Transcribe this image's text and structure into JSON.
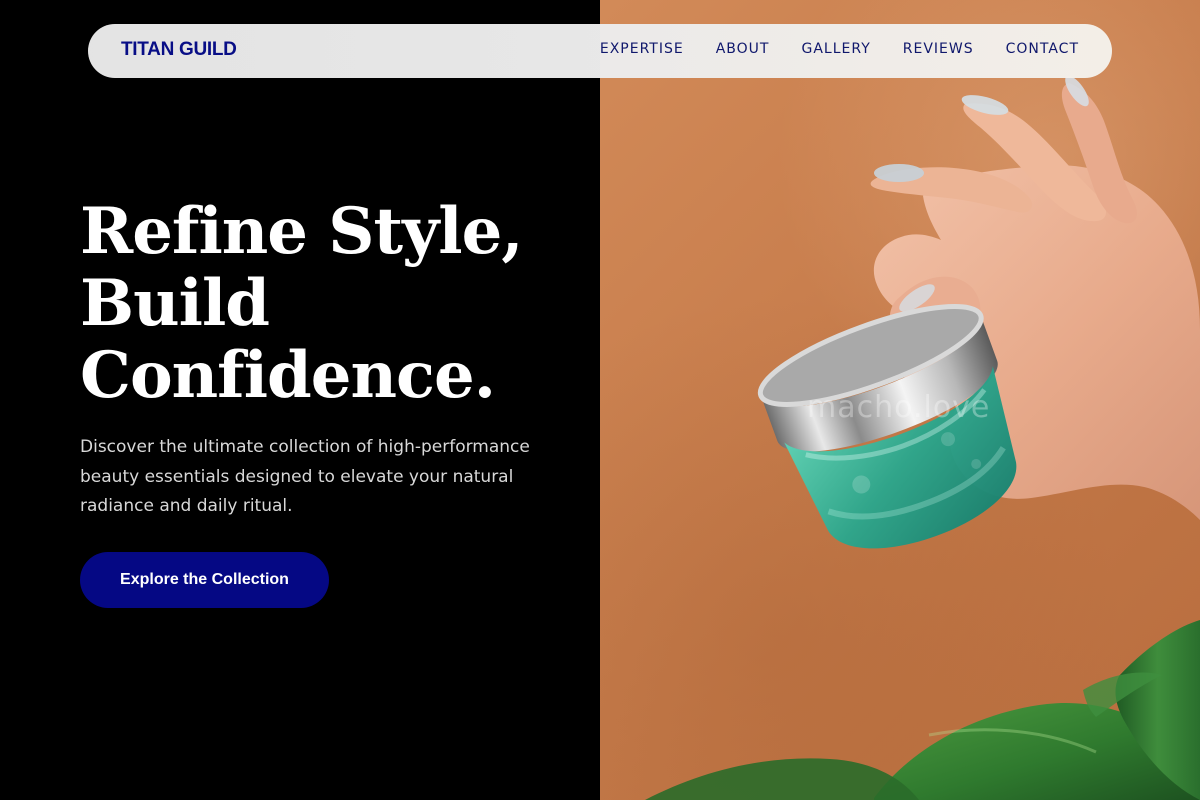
{
  "brand": {
    "name": "TITAN GUILD"
  },
  "navigation": {
    "items": [
      {
        "label": "EXPERTISE"
      },
      {
        "label": "ABOUT"
      },
      {
        "label": "GALLERY"
      },
      {
        "label": "REVIEWS"
      },
      {
        "label": "CONTACT"
      }
    ]
  },
  "hero": {
    "title_lines": [
      "Refine Style,",
      "Build",
      "Confidence."
    ],
    "description": "Discover the ultimate collection of high-performance beauty essentials designed to elevate your natural radiance and daily ritual.",
    "cta_label": "Explore the Collection",
    "image": {
      "watermark": "macho.love"
    }
  },
  "colors": {
    "background": "#000000",
    "brand": "#080E86",
    "button": "#050884",
    "image_background": "#C97F4E",
    "jar": "#2CA68D",
    "leaf": "#2F7A2E"
  }
}
